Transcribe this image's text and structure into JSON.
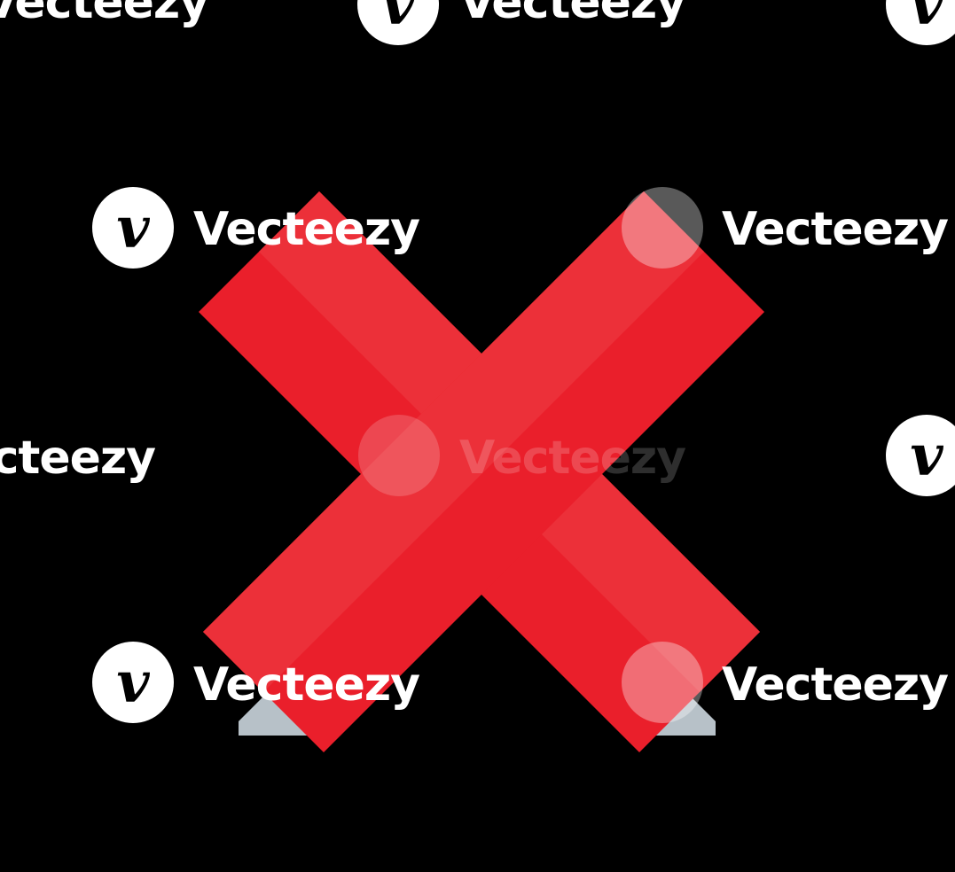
{
  "watermark": {
    "brand": "Vecteezy",
    "logo_glyph": "v",
    "icon": "vecteezy-logo-icon",
    "color": "#ffffff"
  },
  "symbol": {
    "icon": "cross-mark-icon",
    "meaning": "x",
    "colors": {
      "red_dark": "#ea1f2b",
      "red_light": "#ec3039",
      "shadow": "#b7c1c8",
      "background": "#000000"
    }
  }
}
